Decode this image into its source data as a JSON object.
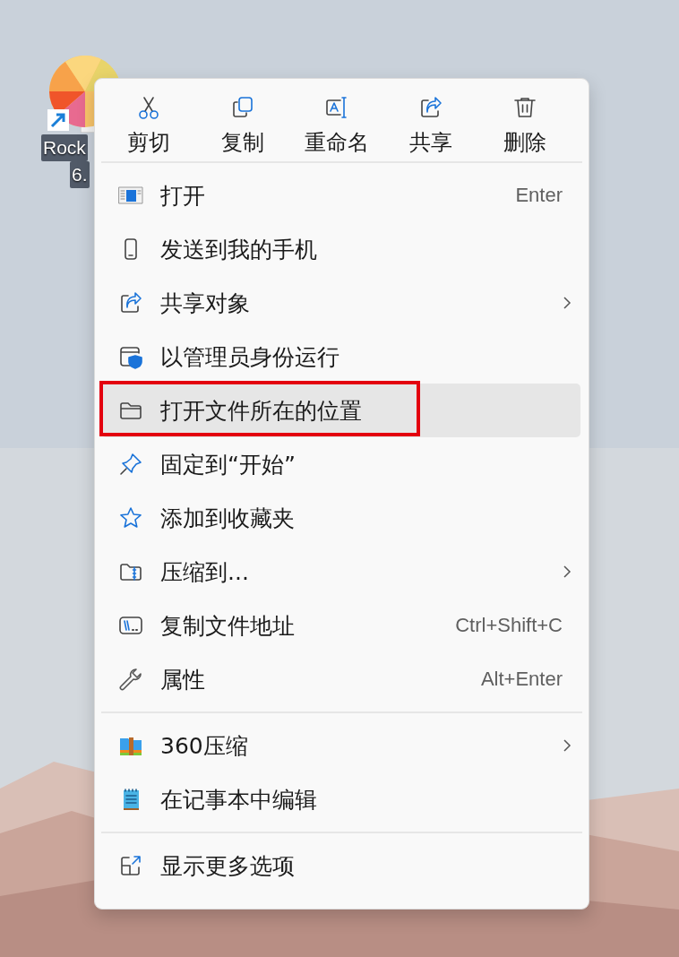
{
  "desktop_icon": {
    "label_lines": [
      "Rock",
      "6."
    ]
  },
  "context_menu": {
    "actions": [
      {
        "kind": "cut",
        "label": "剪切"
      },
      {
        "kind": "copy",
        "label": "复制"
      },
      {
        "kind": "rename",
        "label": "重命名"
      },
      {
        "kind": "share",
        "label": "共享"
      },
      {
        "kind": "delete",
        "label": "删除"
      }
    ],
    "sections": [
      [
        {
          "kind": "open",
          "label": "打开",
          "shortcut": "Enter",
          "submenu": false,
          "selected": false,
          "annotated": false
        },
        {
          "kind": "phone",
          "label": "发送到我的手机",
          "submenu": false,
          "selected": false,
          "annotated": false
        },
        {
          "kind": "share",
          "label": "共享对象",
          "submenu": true,
          "selected": false,
          "annotated": false
        },
        {
          "kind": "admin",
          "label": "以管理员身份运行",
          "submenu": false,
          "selected": false,
          "annotated": false
        },
        {
          "kind": "folder",
          "label": "打开文件所在的位置",
          "submenu": false,
          "selected": true,
          "annotated": true
        },
        {
          "kind": "pin",
          "label": "固定到“开始”",
          "submenu": false,
          "selected": false,
          "annotated": false
        },
        {
          "kind": "star",
          "label": "添加到收藏夹",
          "submenu": false,
          "selected": false,
          "annotated": false
        },
        {
          "kind": "zip",
          "label": "压缩到...",
          "submenu": true,
          "selected": false,
          "annotated": false
        },
        {
          "kind": "path",
          "label": "复制文件地址",
          "shortcut": "Ctrl+Shift+C",
          "submenu": false,
          "selected": false,
          "annotated": false
        },
        {
          "kind": "wrench",
          "label": "属性",
          "shortcut": "Alt+Enter",
          "submenu": false,
          "selected": false,
          "annotated": false
        }
      ],
      [
        {
          "kind": "archive",
          "label": "360压缩",
          "submenu": true,
          "selected": false,
          "annotated": false
        },
        {
          "kind": "notepad",
          "label": "在记事本中编辑",
          "submenu": false,
          "selected": false,
          "annotated": false
        }
      ],
      [
        {
          "kind": "more",
          "label": "显示更多选项",
          "submenu": false,
          "selected": false,
          "annotated": false
        }
      ]
    ]
  }
}
